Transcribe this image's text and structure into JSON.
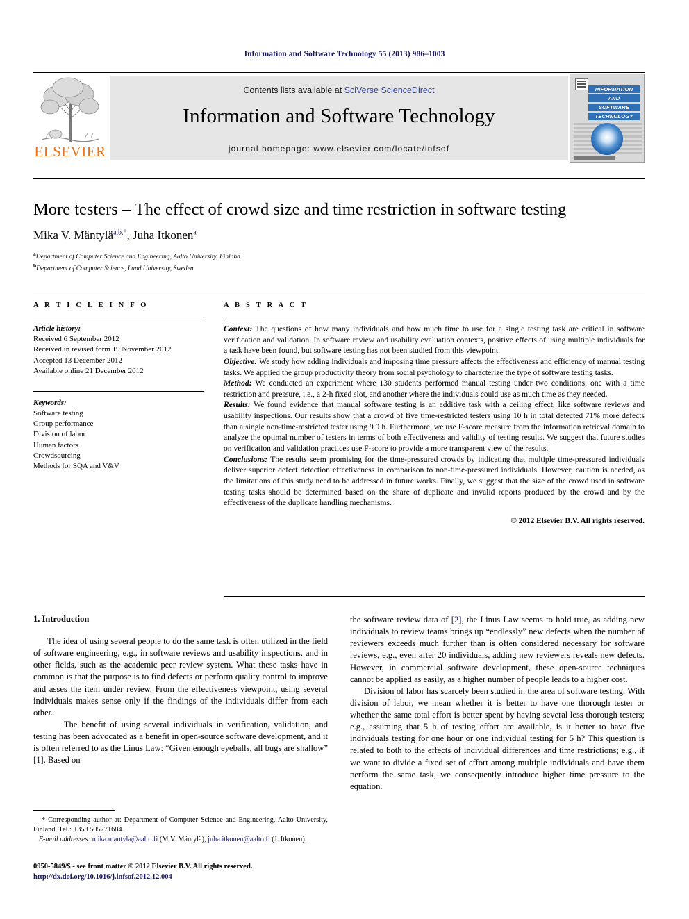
{
  "running_head": "Information and Software Technology 55 (2013) 986–1003",
  "masthead": {
    "publisher_name": "ELSEVIER",
    "publisher_logo_icon": "elsevier-tree-logo",
    "contents_prefix": "Contents lists available at ",
    "contents_link": "SciVerse ScienceDirect",
    "journal_title": "Information and Software Technology",
    "homepage_label": "journal homepage: www.elsevier.com/locate/infsof",
    "cover": {
      "line1": "INFORMATION",
      "line2": "AND",
      "line3": "SOFTWARE",
      "line4": "TECHNOLOGY"
    },
    "link_color": "#2b3fa0",
    "elsevier_orange": "#e8751a",
    "box_background": "#e6e6e6"
  },
  "article": {
    "title": "More testers – The effect of crowd size and time restriction in software testing",
    "authors": [
      {
        "name": "Mika V. Mäntylä",
        "marks": "a,b,*"
      },
      {
        "name": "Juha Itkonen",
        "marks": "a"
      }
    ],
    "affiliations": [
      {
        "mark": "a",
        "text": "Department of Computer Science and Engineering, Aalto University, Finland"
      },
      {
        "mark": "b",
        "text": "Department of Computer Science, Lund University, Sweden"
      }
    ]
  },
  "article_info": {
    "heading": "A R T I C L E    I N F O",
    "history_label": "Article history:",
    "history": [
      "Received 6 September 2012",
      "Received in revised form 19 November 2012",
      "Accepted 13 December 2012",
      "Available online 21 December 2012"
    ],
    "keywords_label": "Keywords:",
    "keywords": [
      "Software testing",
      "Group performance",
      "Division of labor",
      "Human factors",
      "Crowdsourcing",
      "Methods for SQA and V&V"
    ]
  },
  "abstract": {
    "heading": "A B S T R A C T",
    "sections": [
      {
        "lead": "Context:",
        "text": " The questions of how many individuals and how much time to use for a single testing task are critical in software verification and validation. In software review and usability evaluation contexts, positive effects of using multiple individuals for a task have been found, but software testing has not been studied from this viewpoint."
      },
      {
        "lead": "Objective:",
        "text": " We study how adding individuals and imposing time pressure affects the effectiveness and efficiency of manual testing tasks. We applied the group productivity theory from social psychology to characterize the type of software testing tasks."
      },
      {
        "lead": "Method:",
        "text": " We conducted an experiment where 130 students performed manual testing under two conditions, one with a time restriction and pressure, i.e., a 2-h fixed slot, and another where the individuals could use as much time as they needed."
      },
      {
        "lead": "Results:",
        "text": " We found evidence that manual software testing is an additive task with a ceiling effect, like software reviews and usability inspections. Our results show that a crowd of five time-restricted testers using 10 h in total detected 71% more defects than a single non-time-restricted tester using 9.9 h. Furthermore, we use F-score measure from the information retrieval domain to analyze the optimal number of testers in terms of both effectiveness and validity of testing results. We suggest that future studies on verification and validation practices use F-score to provide a more transparent view of the results."
      },
      {
        "lead": "Conclusions:",
        "text": " The results seem promising for the time-pressured crowds by indicating that multiple time-pressured individuals deliver superior defect detection effectiveness in comparison to non-time-pressured individuals. However, caution is needed, as the limitations of this study need to be addressed in future works. Finally, we suggest that the size of the crowd used in software testing tasks should be determined based on the share of duplicate and invalid reports produced by the crowd and by the effectiveness of the duplicate handling mechanisms."
      }
    ],
    "copyright": "© 2012 Elsevier B.V. All rights reserved."
  },
  "body": {
    "section_heading": "1. Introduction",
    "left_paragraphs": [
      "The idea of using several people to do the same task is often utilized in the field of software engineering, e.g., in software reviews and usability inspections, and in other fields, such as the academic peer review system. What these tasks have in common is that the purpose is to find defects or perform quality control to improve and asses the item under review. From the effectiveness viewpoint, using several individuals makes sense only if the findings of the individuals differ from each other.",
      "The benefit of using several individuals in verification, validation, and testing has been advocated as a benefit in open-source software development, and it is often referred to as the Linus Law: “Given enough eyeballs, all bugs are shallow” [1]. Based on"
    ],
    "left_paragraph_2_ref": "[1]",
    "right_paragraphs": [
      "the software review data of [2], the Linus Law seems to hold true, as adding new individuals to review teams brings up “endlessly” new defects when the number of reviewers exceeds much further than is often considered necessary for software reviews, e.g., even after 20 individuals, adding new reviewers reveals new defects. However, in commercial software development, these open-source techniques cannot be applied as easily, as a higher number of people leads to a higher cost.",
      "Division of labor has scarcely been studied in the area of software testing. With division of labor, we mean whether it is better to have one thorough tester or whether the same total effort is better spent by having several less thorough testers; e.g., assuming that 5 h of testing effort are available, is it better to have five individuals testing for one hour or one individual testing for 5 h? This question is related to both to the effects of individual differences and time restrictions; e.g., if we want to divide a fixed set of effort among multiple individuals and have them perform the same task, we consequently introduce higher time pressure to the equation."
    ],
    "right_paragraph_1_ref": "[2]"
  },
  "footnotes": {
    "corresponding_marker": "*",
    "corresponding_text": " Corresponding author at: Department of Computer Science and Engineering, Aalto University, Finland. Tel.: +358 505771684.",
    "email_label": "E-mail addresses:",
    "email_1": "mika.mantyla@aalto.fi",
    "email_1_owner": " (M.V. Mäntylä), ",
    "email_2": "juha.itkonen@aalto.fi",
    "email_2_owner": " (J. Itkonen)."
  },
  "imprint": {
    "line1": "0950-5849/$ - see front matter © 2012 Elsevier B.V. All rights reserved.",
    "doi": "http://dx.doi.org/10.1016/j.infsof.2012.12.004"
  }
}
